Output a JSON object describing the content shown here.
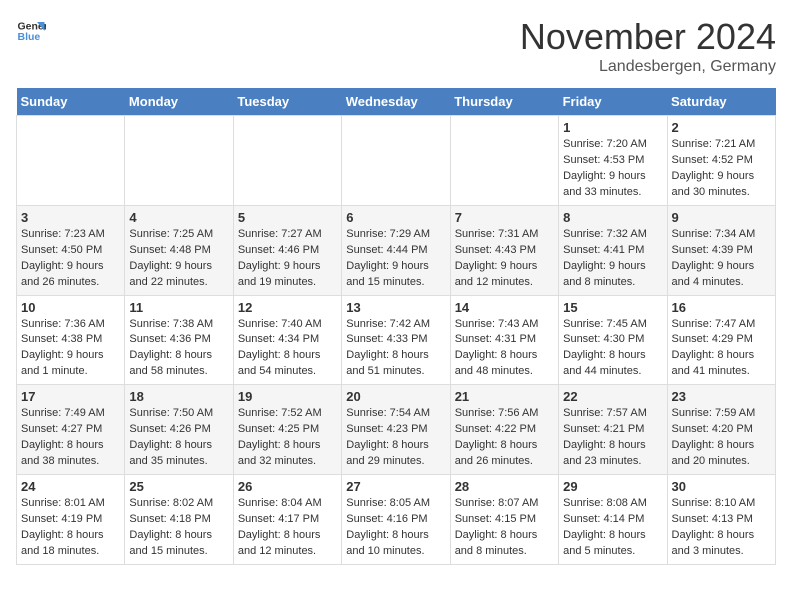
{
  "logo": {
    "text_general": "General",
    "text_blue": "Blue"
  },
  "title": "November 2024",
  "location": "Landesbergen, Germany",
  "days_of_week": [
    "Sunday",
    "Monday",
    "Tuesday",
    "Wednesday",
    "Thursday",
    "Friday",
    "Saturday"
  ],
  "weeks": [
    [
      {
        "day": "",
        "info": ""
      },
      {
        "day": "",
        "info": ""
      },
      {
        "day": "",
        "info": ""
      },
      {
        "day": "",
        "info": ""
      },
      {
        "day": "",
        "info": ""
      },
      {
        "day": "1",
        "info": "Sunrise: 7:20 AM\nSunset: 4:53 PM\nDaylight: 9 hours\nand 33 minutes."
      },
      {
        "day": "2",
        "info": "Sunrise: 7:21 AM\nSunset: 4:52 PM\nDaylight: 9 hours\nand 30 minutes."
      }
    ],
    [
      {
        "day": "3",
        "info": "Sunrise: 7:23 AM\nSunset: 4:50 PM\nDaylight: 9 hours\nand 26 minutes."
      },
      {
        "day": "4",
        "info": "Sunrise: 7:25 AM\nSunset: 4:48 PM\nDaylight: 9 hours\nand 22 minutes."
      },
      {
        "day": "5",
        "info": "Sunrise: 7:27 AM\nSunset: 4:46 PM\nDaylight: 9 hours\nand 19 minutes."
      },
      {
        "day": "6",
        "info": "Sunrise: 7:29 AM\nSunset: 4:44 PM\nDaylight: 9 hours\nand 15 minutes."
      },
      {
        "day": "7",
        "info": "Sunrise: 7:31 AM\nSunset: 4:43 PM\nDaylight: 9 hours\nand 12 minutes."
      },
      {
        "day": "8",
        "info": "Sunrise: 7:32 AM\nSunset: 4:41 PM\nDaylight: 9 hours\nand 8 minutes."
      },
      {
        "day": "9",
        "info": "Sunrise: 7:34 AM\nSunset: 4:39 PM\nDaylight: 9 hours\nand 4 minutes."
      }
    ],
    [
      {
        "day": "10",
        "info": "Sunrise: 7:36 AM\nSunset: 4:38 PM\nDaylight: 9 hours\nand 1 minute."
      },
      {
        "day": "11",
        "info": "Sunrise: 7:38 AM\nSunset: 4:36 PM\nDaylight: 8 hours\nand 58 minutes."
      },
      {
        "day": "12",
        "info": "Sunrise: 7:40 AM\nSunset: 4:34 PM\nDaylight: 8 hours\nand 54 minutes."
      },
      {
        "day": "13",
        "info": "Sunrise: 7:42 AM\nSunset: 4:33 PM\nDaylight: 8 hours\nand 51 minutes."
      },
      {
        "day": "14",
        "info": "Sunrise: 7:43 AM\nSunset: 4:31 PM\nDaylight: 8 hours\nand 48 minutes."
      },
      {
        "day": "15",
        "info": "Sunrise: 7:45 AM\nSunset: 4:30 PM\nDaylight: 8 hours\nand 44 minutes."
      },
      {
        "day": "16",
        "info": "Sunrise: 7:47 AM\nSunset: 4:29 PM\nDaylight: 8 hours\nand 41 minutes."
      }
    ],
    [
      {
        "day": "17",
        "info": "Sunrise: 7:49 AM\nSunset: 4:27 PM\nDaylight: 8 hours\nand 38 minutes."
      },
      {
        "day": "18",
        "info": "Sunrise: 7:50 AM\nSunset: 4:26 PM\nDaylight: 8 hours\nand 35 minutes."
      },
      {
        "day": "19",
        "info": "Sunrise: 7:52 AM\nSunset: 4:25 PM\nDaylight: 8 hours\nand 32 minutes."
      },
      {
        "day": "20",
        "info": "Sunrise: 7:54 AM\nSunset: 4:23 PM\nDaylight: 8 hours\nand 29 minutes."
      },
      {
        "day": "21",
        "info": "Sunrise: 7:56 AM\nSunset: 4:22 PM\nDaylight: 8 hours\nand 26 minutes."
      },
      {
        "day": "22",
        "info": "Sunrise: 7:57 AM\nSunset: 4:21 PM\nDaylight: 8 hours\nand 23 minutes."
      },
      {
        "day": "23",
        "info": "Sunrise: 7:59 AM\nSunset: 4:20 PM\nDaylight: 8 hours\nand 20 minutes."
      }
    ],
    [
      {
        "day": "24",
        "info": "Sunrise: 8:01 AM\nSunset: 4:19 PM\nDaylight: 8 hours\nand 18 minutes."
      },
      {
        "day": "25",
        "info": "Sunrise: 8:02 AM\nSunset: 4:18 PM\nDaylight: 8 hours\nand 15 minutes."
      },
      {
        "day": "26",
        "info": "Sunrise: 8:04 AM\nSunset: 4:17 PM\nDaylight: 8 hours\nand 12 minutes."
      },
      {
        "day": "27",
        "info": "Sunrise: 8:05 AM\nSunset: 4:16 PM\nDaylight: 8 hours\nand 10 minutes."
      },
      {
        "day": "28",
        "info": "Sunrise: 8:07 AM\nSunset: 4:15 PM\nDaylight: 8 hours\nand 8 minutes."
      },
      {
        "day": "29",
        "info": "Sunrise: 8:08 AM\nSunset: 4:14 PM\nDaylight: 8 hours\nand 5 minutes."
      },
      {
        "day": "30",
        "info": "Sunrise: 8:10 AM\nSunset: 4:13 PM\nDaylight: 8 hours\nand 3 minutes."
      }
    ]
  ]
}
